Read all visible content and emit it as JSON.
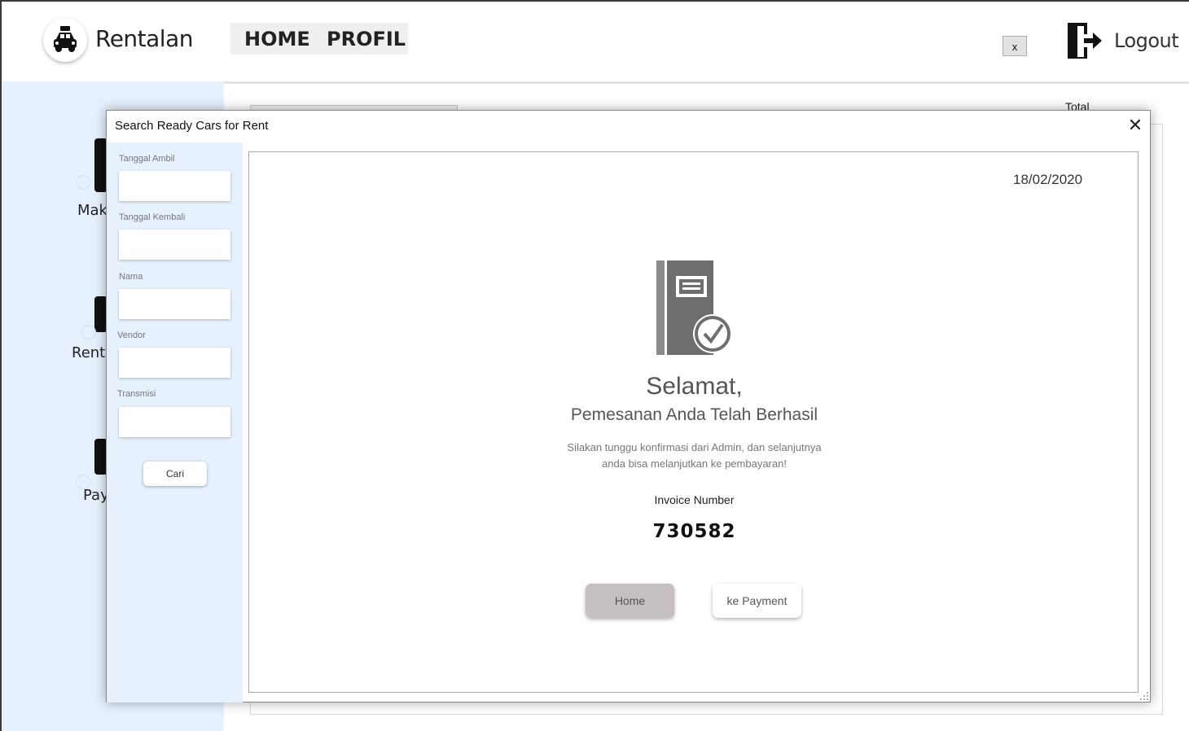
{
  "header": {
    "brand": "Rentalan",
    "nav": {
      "home": "HOME",
      "profil": "PROFIL"
    },
    "close_small_label": "x",
    "logout_label": "Logout"
  },
  "background": {
    "sidebar_items": [
      {
        "label": "Make"
      },
      {
        "label": "Rents"
      },
      {
        "label": "Pay"
      }
    ],
    "total_label": "Total"
  },
  "modal": {
    "title": "Search Ready Cars for Rent",
    "close_glyph": "✕",
    "filters": {
      "tanggal_ambil": {
        "label": "Tanggal Ambil",
        "value": ""
      },
      "tanggal_kembali": {
        "label": "Tanggal Kembali",
        "value": ""
      },
      "nama": {
        "label": "Nama",
        "value": ""
      },
      "vendor": {
        "label": "Vendor",
        "value": ""
      },
      "transmisi": {
        "label": "Transmisi",
        "value": ""
      },
      "search_button": "Cari"
    },
    "confirmation": {
      "date": "18/02/2020",
      "heading": "Selamat,",
      "subheading": "Pemesanan Anda Telah Berhasil",
      "message_line1": "Silakan tunggu konfirmasi dari Admin, dan selanjutnya",
      "message_line2": "anda bisa melanjutkan ke pembayaran!",
      "invoice_label": "Invoice Number",
      "invoice_number": "730582",
      "home_button": "Home",
      "payment_button": "ke Payment"
    }
  },
  "colors": {
    "sidebar_bg": "#e6f1fd",
    "home_button_bg": "#c6bfbf",
    "nav_bg": "#efefef"
  }
}
